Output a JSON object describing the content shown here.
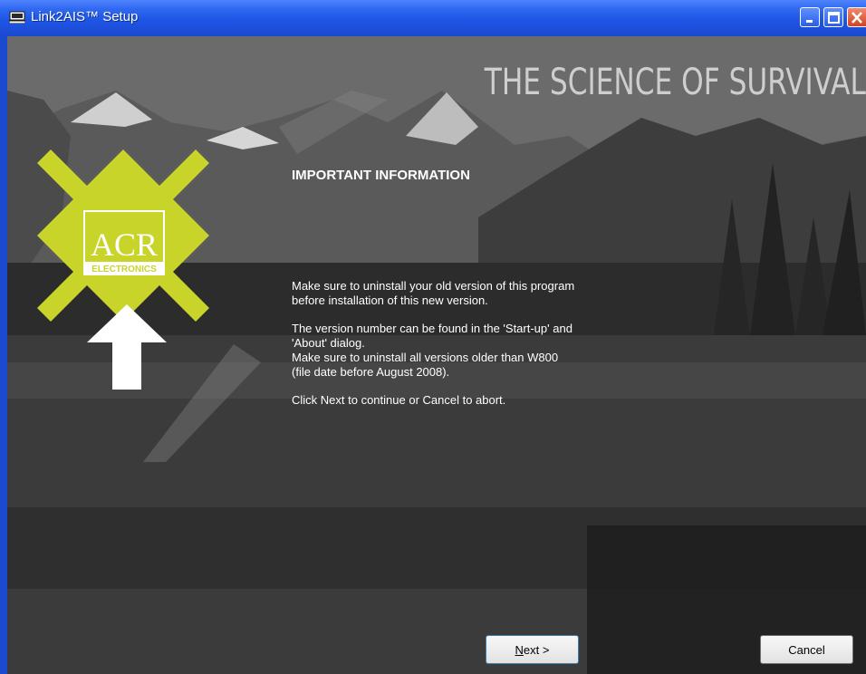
{
  "window": {
    "title": "Link2AIS™ Setup"
  },
  "banner": {
    "tagline": "THE SCIENCE OF SURVIVAL",
    "logo_text": "ACR",
    "logo_subtext": "ELECTRONICS"
  },
  "content": {
    "heading": "IMPORTANT INFORMATION",
    "para1_line1": "Make sure to uninstall your old version of this program",
    "para1_line2": "before installation of this new version.",
    "para2_line1": "The version number can be found in the 'Start-up' and",
    "para2_line2": "'About' dialog.",
    "para2_line3": "Make sure to uninstall all versions older than W800",
    "para2_line4": "(file date before August 2008).",
    "para3": "Click Next to continue or Cancel to abort."
  },
  "buttons": {
    "next_mnemonic": "N",
    "next_rest": "ext >",
    "cancel": "Cancel"
  },
  "colors": {
    "titlebar": "#2f69f0",
    "logo_yellow": "#c9d42a",
    "text": "#ffffff"
  }
}
